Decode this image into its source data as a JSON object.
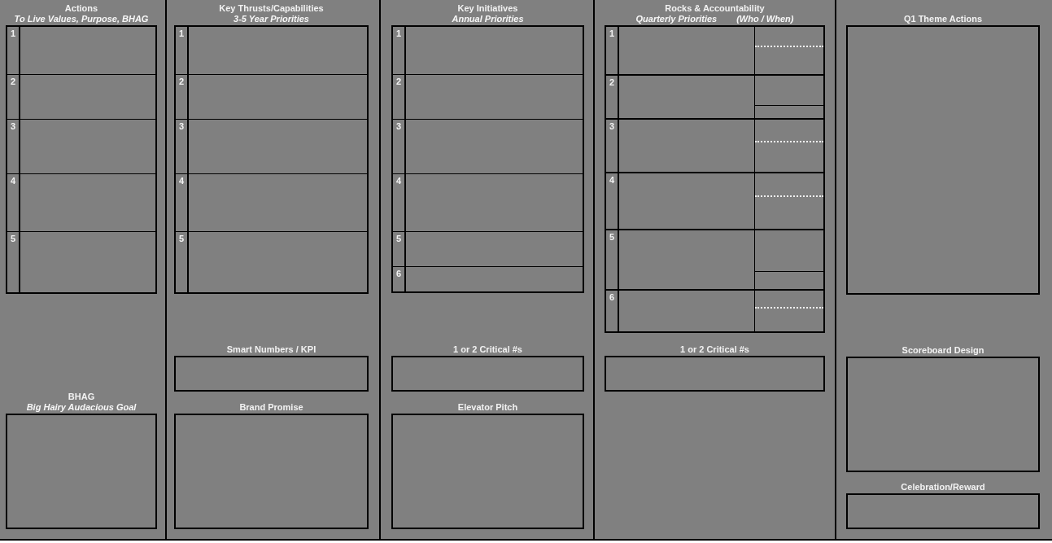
{
  "columns": [
    {
      "title": "Actions",
      "subtitle": [
        "To Live Values, Purpose, BHAG"
      ],
      "main": {
        "kind": "numbered",
        "rows": [
          {
            "number": "1"
          },
          {
            "number": "2"
          },
          {
            "number": "3"
          },
          {
            "number": "4"
          },
          {
            "number": "5"
          }
        ]
      },
      "sections": [
        {
          "kind": "large",
          "title": "BHAG",
          "subtitle": "Big Hairy Audacious Goal"
        }
      ]
    },
    {
      "title": "Key Thrusts/Capabilities",
      "subtitle": [
        "3-5 Year Priorities"
      ],
      "main": {
        "kind": "numbered",
        "rows": [
          {
            "number": "1"
          },
          {
            "number": "2"
          },
          {
            "number": "3"
          },
          {
            "number": "4"
          },
          {
            "number": "5"
          }
        ]
      },
      "sections": [
        {
          "kind": "small",
          "title": "Smart Numbers / KPI"
        },
        {
          "kind": "large",
          "title": "Brand Promise"
        }
      ]
    },
    {
      "title": "Key Initiatives",
      "subtitle": [
        "Annual Priorities"
      ],
      "main": {
        "kind": "numbered",
        "rows": [
          {
            "number": "1"
          },
          {
            "number": "2"
          },
          {
            "number": "3"
          },
          {
            "number": "4"
          },
          {
            "number": "5"
          },
          {
            "number": "6"
          }
        ]
      },
      "sections": [
        {
          "kind": "small",
          "title": "1 or 2 Critical #s"
        },
        {
          "kind": "large",
          "title": "Elevator Pitch"
        }
      ]
    },
    {
      "title": "Rocks & Accountability",
      "subtitle": [
        "Quarterly Priorities",
        "(Who / When)"
      ],
      "main": {
        "kind": "numbered",
        "rows": [
          {
            "number": "1",
            "who": {
              "kind": "dotted"
            }
          },
          {
            "number": "2",
            "who": {
              "kind": "solid"
            }
          },
          {
            "number": "3",
            "who": {
              "kind": "dotted"
            }
          },
          {
            "number": "4",
            "who": {
              "kind": "dotted"
            }
          },
          {
            "number": "5",
            "who": {
              "kind": "solid"
            }
          },
          {
            "number": "6",
            "who": {
              "kind": "dotted"
            }
          }
        ]
      },
      "sections": [
        {
          "kind": "small",
          "title": "1 or 2 Critical #s"
        }
      ]
    },
    {
      "title": "Q1 Theme Actions",
      "main": {
        "kind": "blank"
      },
      "sections": [
        {
          "kind": "large",
          "title": "Scoreboard Design"
        },
        {
          "kind": "small",
          "title": "Celebration/Reward"
        }
      ]
    }
  ]
}
